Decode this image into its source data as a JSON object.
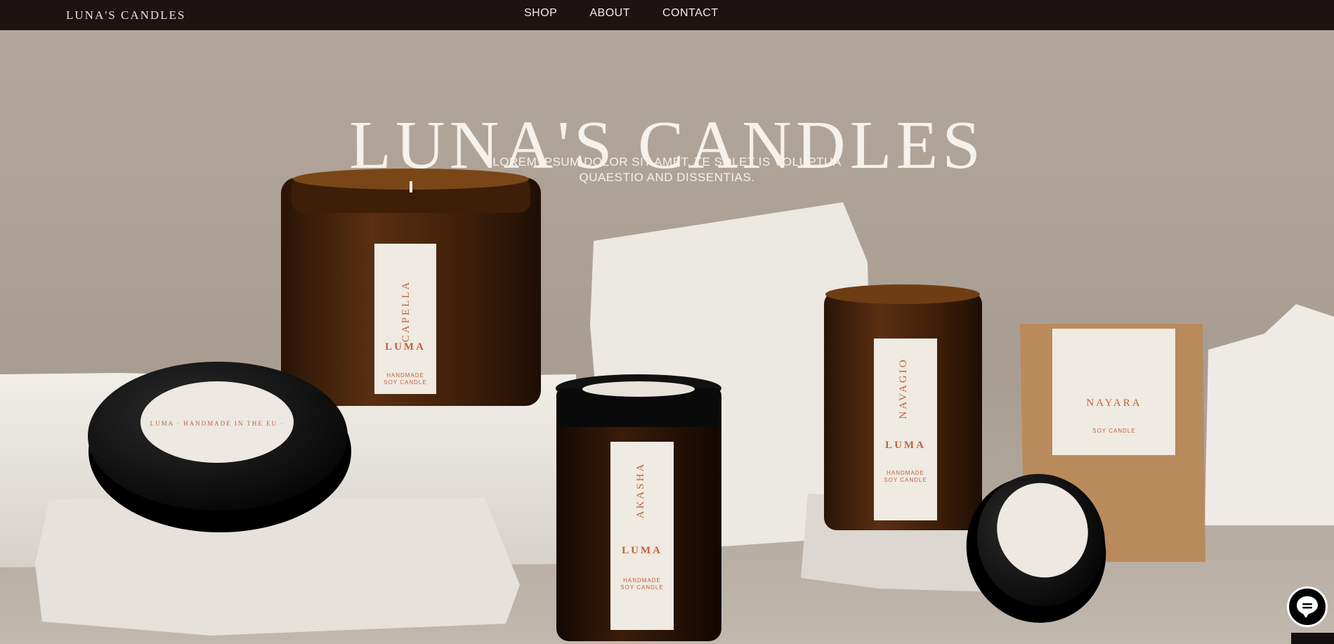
{
  "nav": {
    "brand": "LUNA'S CANDLES",
    "links": [
      "SHOP",
      "ABOUT",
      "CONTACT"
    ]
  },
  "hero": {
    "title": "LUNA'S CANDLES",
    "subtitle_line1": "LOREM IPSUM DOLOR SIT AMET, TE SOLET IS VOLUPTUA",
    "subtitle_line2": "QUAESTIO AND DISSENTIAS.",
    "labels": {
      "capella_name": "CAPELLA",
      "capella_brand": "LUMA",
      "capella_sub1": "HANDMADE",
      "capella_sub2": "SOY CANDLE",
      "akasha_name": "AKASHA",
      "akasha_brand": "LUMA",
      "akasha_sub1": "HANDMADE",
      "akasha_sub2": "SOY CANDLE",
      "navagio_name": "NAVAGIO",
      "navagio_brand": "LUMA",
      "navagio_sub1": "HANDMADE",
      "navagio_sub2": "SOY CANDLE",
      "nayara_name": "NAYARA",
      "nayara_sub": "SOY CANDLE",
      "lid_text": "LUMA · HANDMADE IN THE EU ·"
    }
  },
  "colors": {
    "nav_bg": "#1c1312",
    "backdrop": "#ada196",
    "amber_glass": "#5a2f12",
    "label_accent": "#c0623a",
    "kraft_box": "#b98a5c"
  },
  "chat": {
    "icon": "chat-bubble-icon"
  }
}
